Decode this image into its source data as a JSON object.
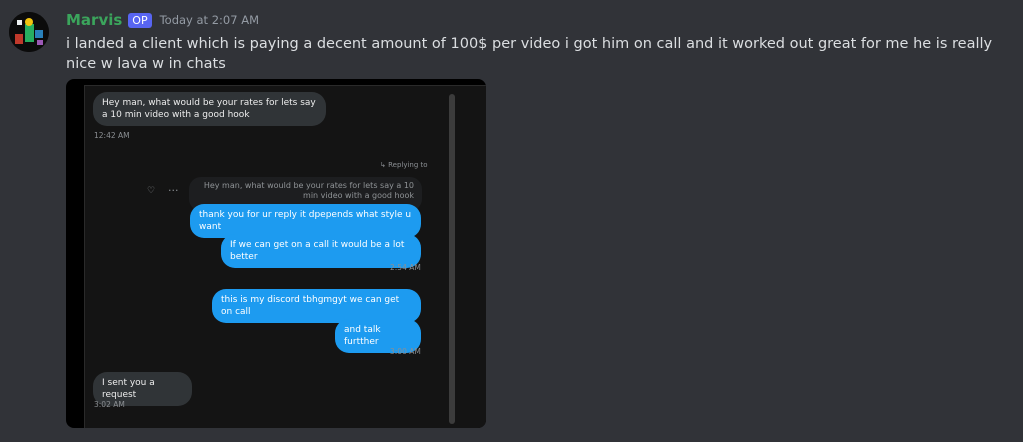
{
  "message": {
    "username": "Marvis",
    "badge": "OP",
    "timestamp": "Today at 2:07 AM",
    "text": "i landed a client which is paying a decent amount of 100$ per video i got him on call and it worked out great for me he is really nice w lava w in chats",
    "username_color": "#3ba55c",
    "badge_color": "#5865f2"
  },
  "screenshot": {
    "incoming_1": "Hey man, what would be your rates for lets say a 10 min video with a good hook",
    "time_1": "12:42 AM",
    "replying_label": "Replying to",
    "quoted_text": "Hey man, what would be your rates for lets say a 10 min video with a good hook",
    "outgoing_1": "thank you for ur reply it dpepends what style u want",
    "outgoing_2": "If we can get on a call it would be a lot better",
    "time_2": "2:54 AM",
    "outgoing_3": "this is my discord tbhgmgyt  we can get on call",
    "outgoing_4": "and talk furtther",
    "time_3": "3:00 AM",
    "incoming_2": "I sent you a request",
    "time_4": "3:02 AM",
    "bubble_out_color": "#1d9bf0",
    "bubble_in_color": "#303437"
  }
}
